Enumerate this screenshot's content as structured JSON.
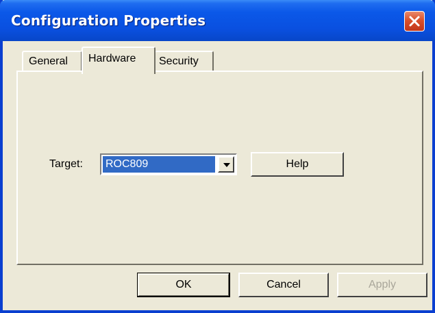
{
  "window": {
    "title": "Configuration Properties",
    "close_icon": "close-icon",
    "colors": {
      "titlebar": "#0a50e0",
      "close_button": "#d9502b",
      "face": "#ece9d8",
      "selection": "#316ac5"
    }
  },
  "tabs": [
    {
      "label": "General",
      "selected": false
    },
    {
      "label": "Hardware",
      "selected": true
    },
    {
      "label": "Security",
      "selected": false
    }
  ],
  "hardware": {
    "target_label": "Target:",
    "target_value": "ROC809",
    "dropdown_icon": "chevron-down-icon",
    "help_label": "Help"
  },
  "buttons": {
    "ok": "OK",
    "cancel": "Cancel",
    "apply": "Apply",
    "apply_enabled": false
  }
}
